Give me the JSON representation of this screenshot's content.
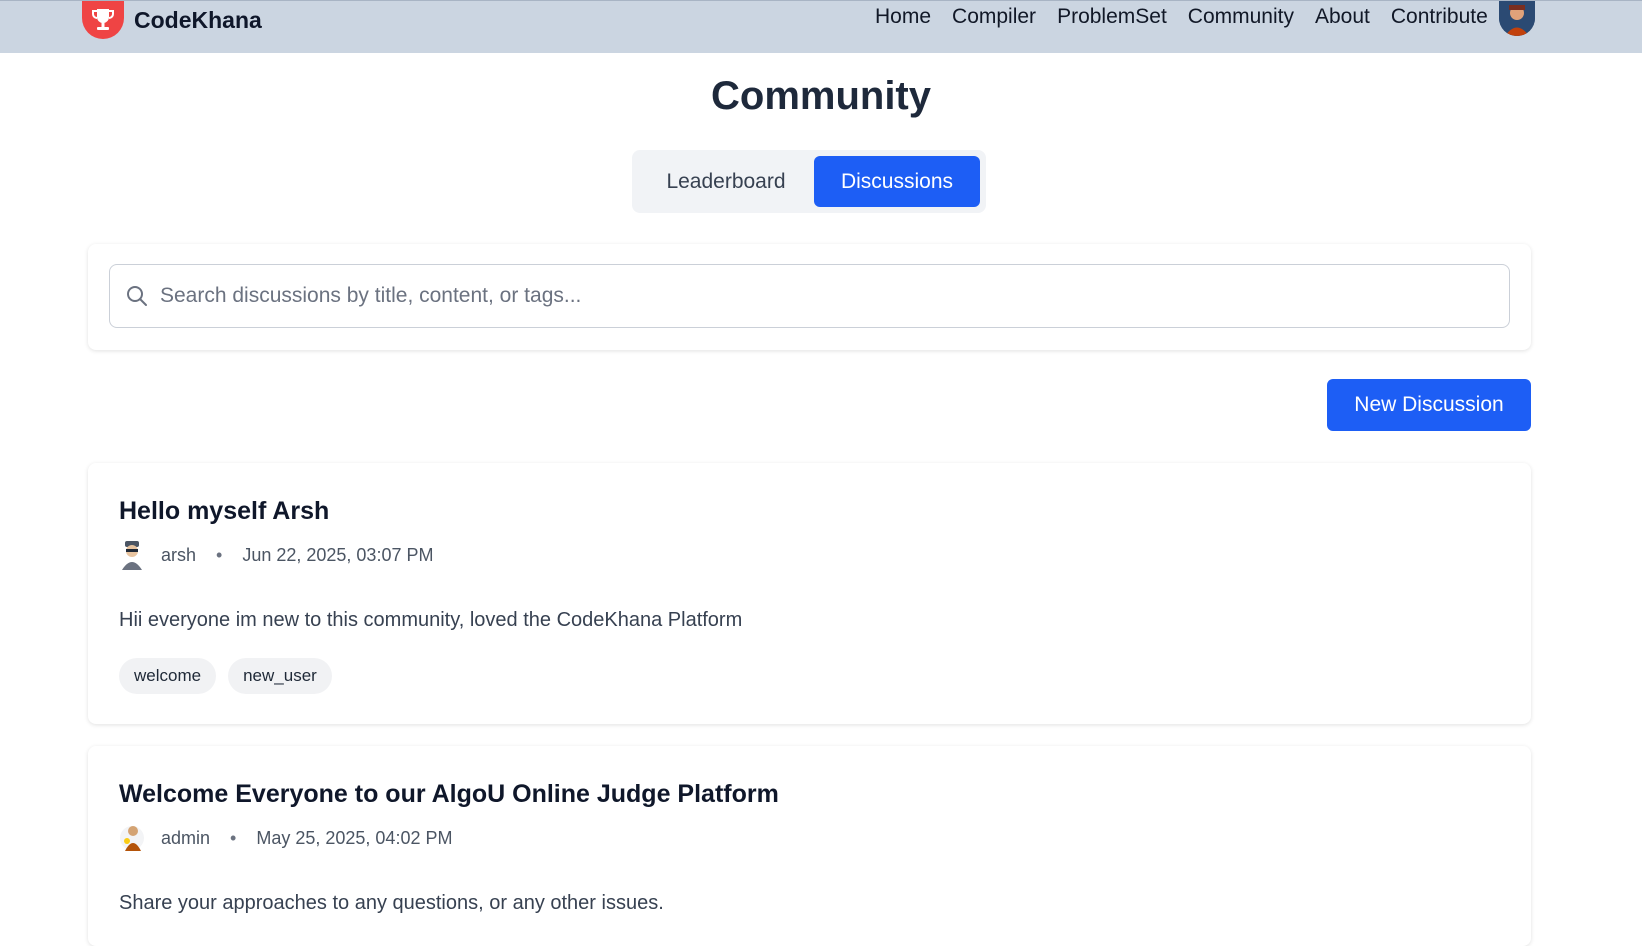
{
  "navbar": {
    "brand": "CodeKhana",
    "links": [
      "Home",
      "Compiler",
      "ProblemSet",
      "Community",
      "About",
      "Contribute"
    ]
  },
  "page": {
    "title": "Community",
    "tabs": [
      {
        "label": "Leaderboard",
        "active": false
      },
      {
        "label": "Discussions",
        "active": true
      }
    ]
  },
  "search": {
    "placeholder": "Search discussions by title, content, or tags..."
  },
  "actions": {
    "new_discussion": "New Discussion"
  },
  "discussions": [
    {
      "title": "Hello myself Arsh",
      "author": "arsh",
      "separator": "•",
      "date": "Jun 22, 2025, 03:07 PM",
      "content": "Hii everyone im new to this community, loved the CodeKhana Platform",
      "tags": [
        "welcome",
        "new_user"
      ]
    },
    {
      "title": "Welcome Everyone to our AlgoU Online Judge Platform",
      "author": "admin",
      "separator": "•",
      "date": "May 25, 2025, 04:02 PM",
      "content": "Share your approaches to any questions, or any other issues.",
      "tags": []
    }
  ],
  "colors": {
    "accent": "#1d5ef5",
    "navbar_bg": "#cbd5e1",
    "brand_logo": "#ef4444"
  }
}
